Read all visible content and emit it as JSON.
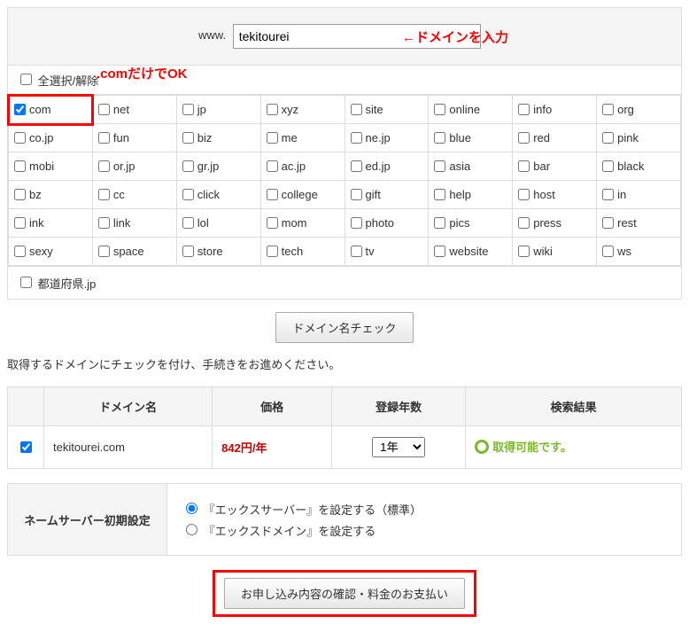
{
  "search": {
    "www": "www.",
    "value": "tekitourei",
    "dot": ".",
    "annot_input": "←ドメインを入力"
  },
  "select_all": "全選択/解除",
  "annot_com": ".comだけでOK",
  "tlds": [
    [
      "com",
      "net",
      "jp",
      "xyz",
      "site",
      "online",
      "info",
      "org"
    ],
    [
      "co.jp",
      "fun",
      "biz",
      "me",
      "ne.jp",
      "blue",
      "red",
      "pink"
    ],
    [
      "mobi",
      "or.jp",
      "gr.jp",
      "ac.jp",
      "ed.jp",
      "asia",
      "bar",
      "black"
    ],
    [
      "bz",
      "cc",
      "click",
      "college",
      "gift",
      "help",
      "host",
      "in"
    ],
    [
      "ink",
      "link",
      "lol",
      "mom",
      "photo",
      "pics",
      "press",
      "rest"
    ],
    [
      "sexy",
      "space",
      "store",
      "tech",
      "tv",
      "website",
      "wiki",
      "ws"
    ]
  ],
  "pref_jp": "都道府県.jp",
  "check_button": "ドメイン名チェック",
  "instruction": "取得するドメインにチェックを付け、手続きをお進めください。",
  "result": {
    "headers": {
      "domain": "ドメイン名",
      "price": "価格",
      "years": "登録年数",
      "status": "検索結果"
    },
    "row": {
      "domain": "tekitourei.com",
      "price": "842円/年",
      "years": "1年",
      "status": "取得可能です。"
    }
  },
  "ns": {
    "header": "ネームサーバー初期設定",
    "opt1": "『エックスサーバー』を設定する（標準）",
    "opt2": "『エックスドメイン』を設定する"
  },
  "submit_button": "お申し込み内容の確認・料金のお支払い"
}
